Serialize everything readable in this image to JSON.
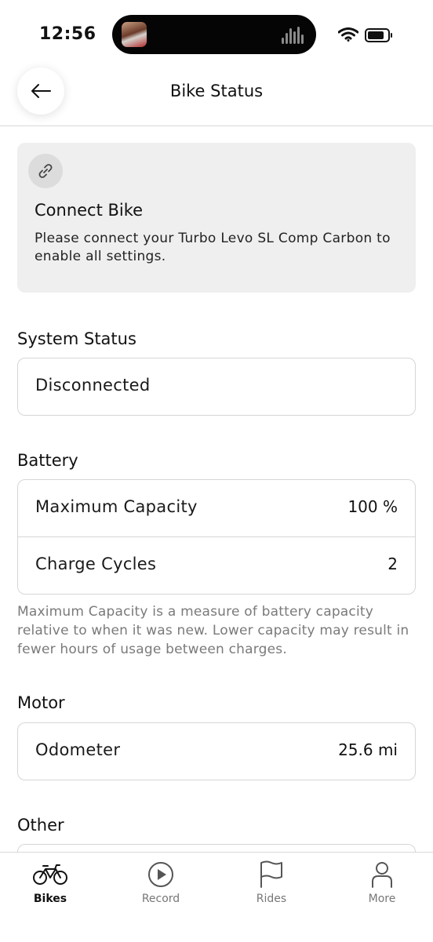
{
  "status_bar": {
    "time": "12:56"
  },
  "nav": {
    "title": "Bike Status"
  },
  "connect_card": {
    "title": "Connect Bike",
    "text": "Please connect your Turbo Levo SL Comp Carbon to enable all settings."
  },
  "system_status": {
    "title": "System Status",
    "value": "Disconnected"
  },
  "battery": {
    "title": "Battery",
    "rows": [
      {
        "label": "Maximum Capacity",
        "value": "100 %"
      },
      {
        "label": "Charge Cycles",
        "value": "2"
      }
    ],
    "note": "Maximum Capacity is a measure of battery capacity relative to when it was new. Lower capacity may result in fewer hours of usage between charges."
  },
  "motor": {
    "title": "Motor",
    "rows": [
      {
        "label": "Odometer",
        "value": "25.6 mi"
      }
    ]
  },
  "other": {
    "title": "Other"
  },
  "tabs": [
    {
      "label": "Bikes",
      "icon": "bike-icon",
      "active": true
    },
    {
      "label": "Record",
      "icon": "play-circle-icon",
      "active": false
    },
    {
      "label": "Rides",
      "icon": "flag-icon",
      "active": false
    },
    {
      "label": "More",
      "icon": "person-icon",
      "active": false
    }
  ]
}
